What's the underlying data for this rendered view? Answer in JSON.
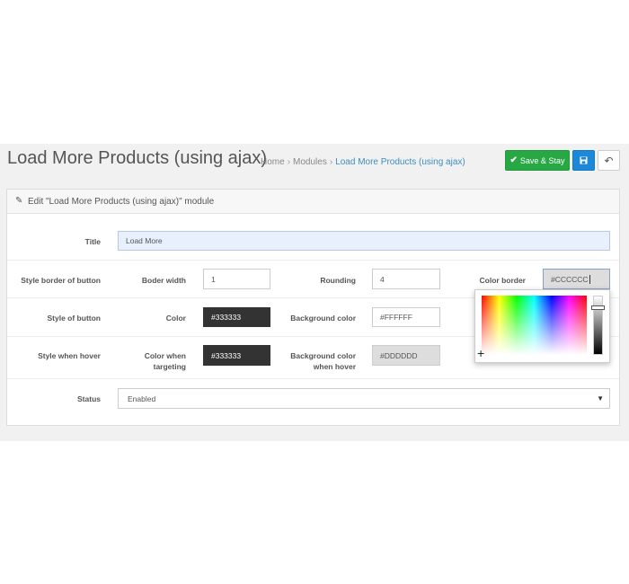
{
  "header": {
    "title": "Load More Products (using ajax)",
    "breadcrumb": [
      "Home",
      "Modules",
      "Load More Products (using ajax)"
    ],
    "save_stay_label": "Save & Stay"
  },
  "panel": {
    "title": "Edit \"Load More Products (using ajax)\" module"
  },
  "form": {
    "title_label": "Title",
    "title_value": "Load More",
    "style_border_label": "Style border of button",
    "border_width_label": "Boder width",
    "border_width_value": "1",
    "rounding_label": "Rounding",
    "rounding_value": "4",
    "color_border_label": "Color border",
    "color_border_value": "#CCCCCC",
    "style_button_label": "Style of button",
    "color_label": "Color",
    "color_value": "#333333",
    "bg_color_label": "Background color",
    "bg_color_value": "#FFFFFF",
    "style_hover_label": "Style when hover",
    "color_targeting_label": "Color when targeting",
    "color_targeting_value": "#333333",
    "bg_hover_label": "Background color when hover",
    "bg_hover_value": "#DDDDDD",
    "status_label": "Status",
    "status_value": "Enabled"
  },
  "colors": {
    "accent_green": "#28a745",
    "accent_blue": "#1e88d8",
    "link": "#3c8dbc"
  }
}
